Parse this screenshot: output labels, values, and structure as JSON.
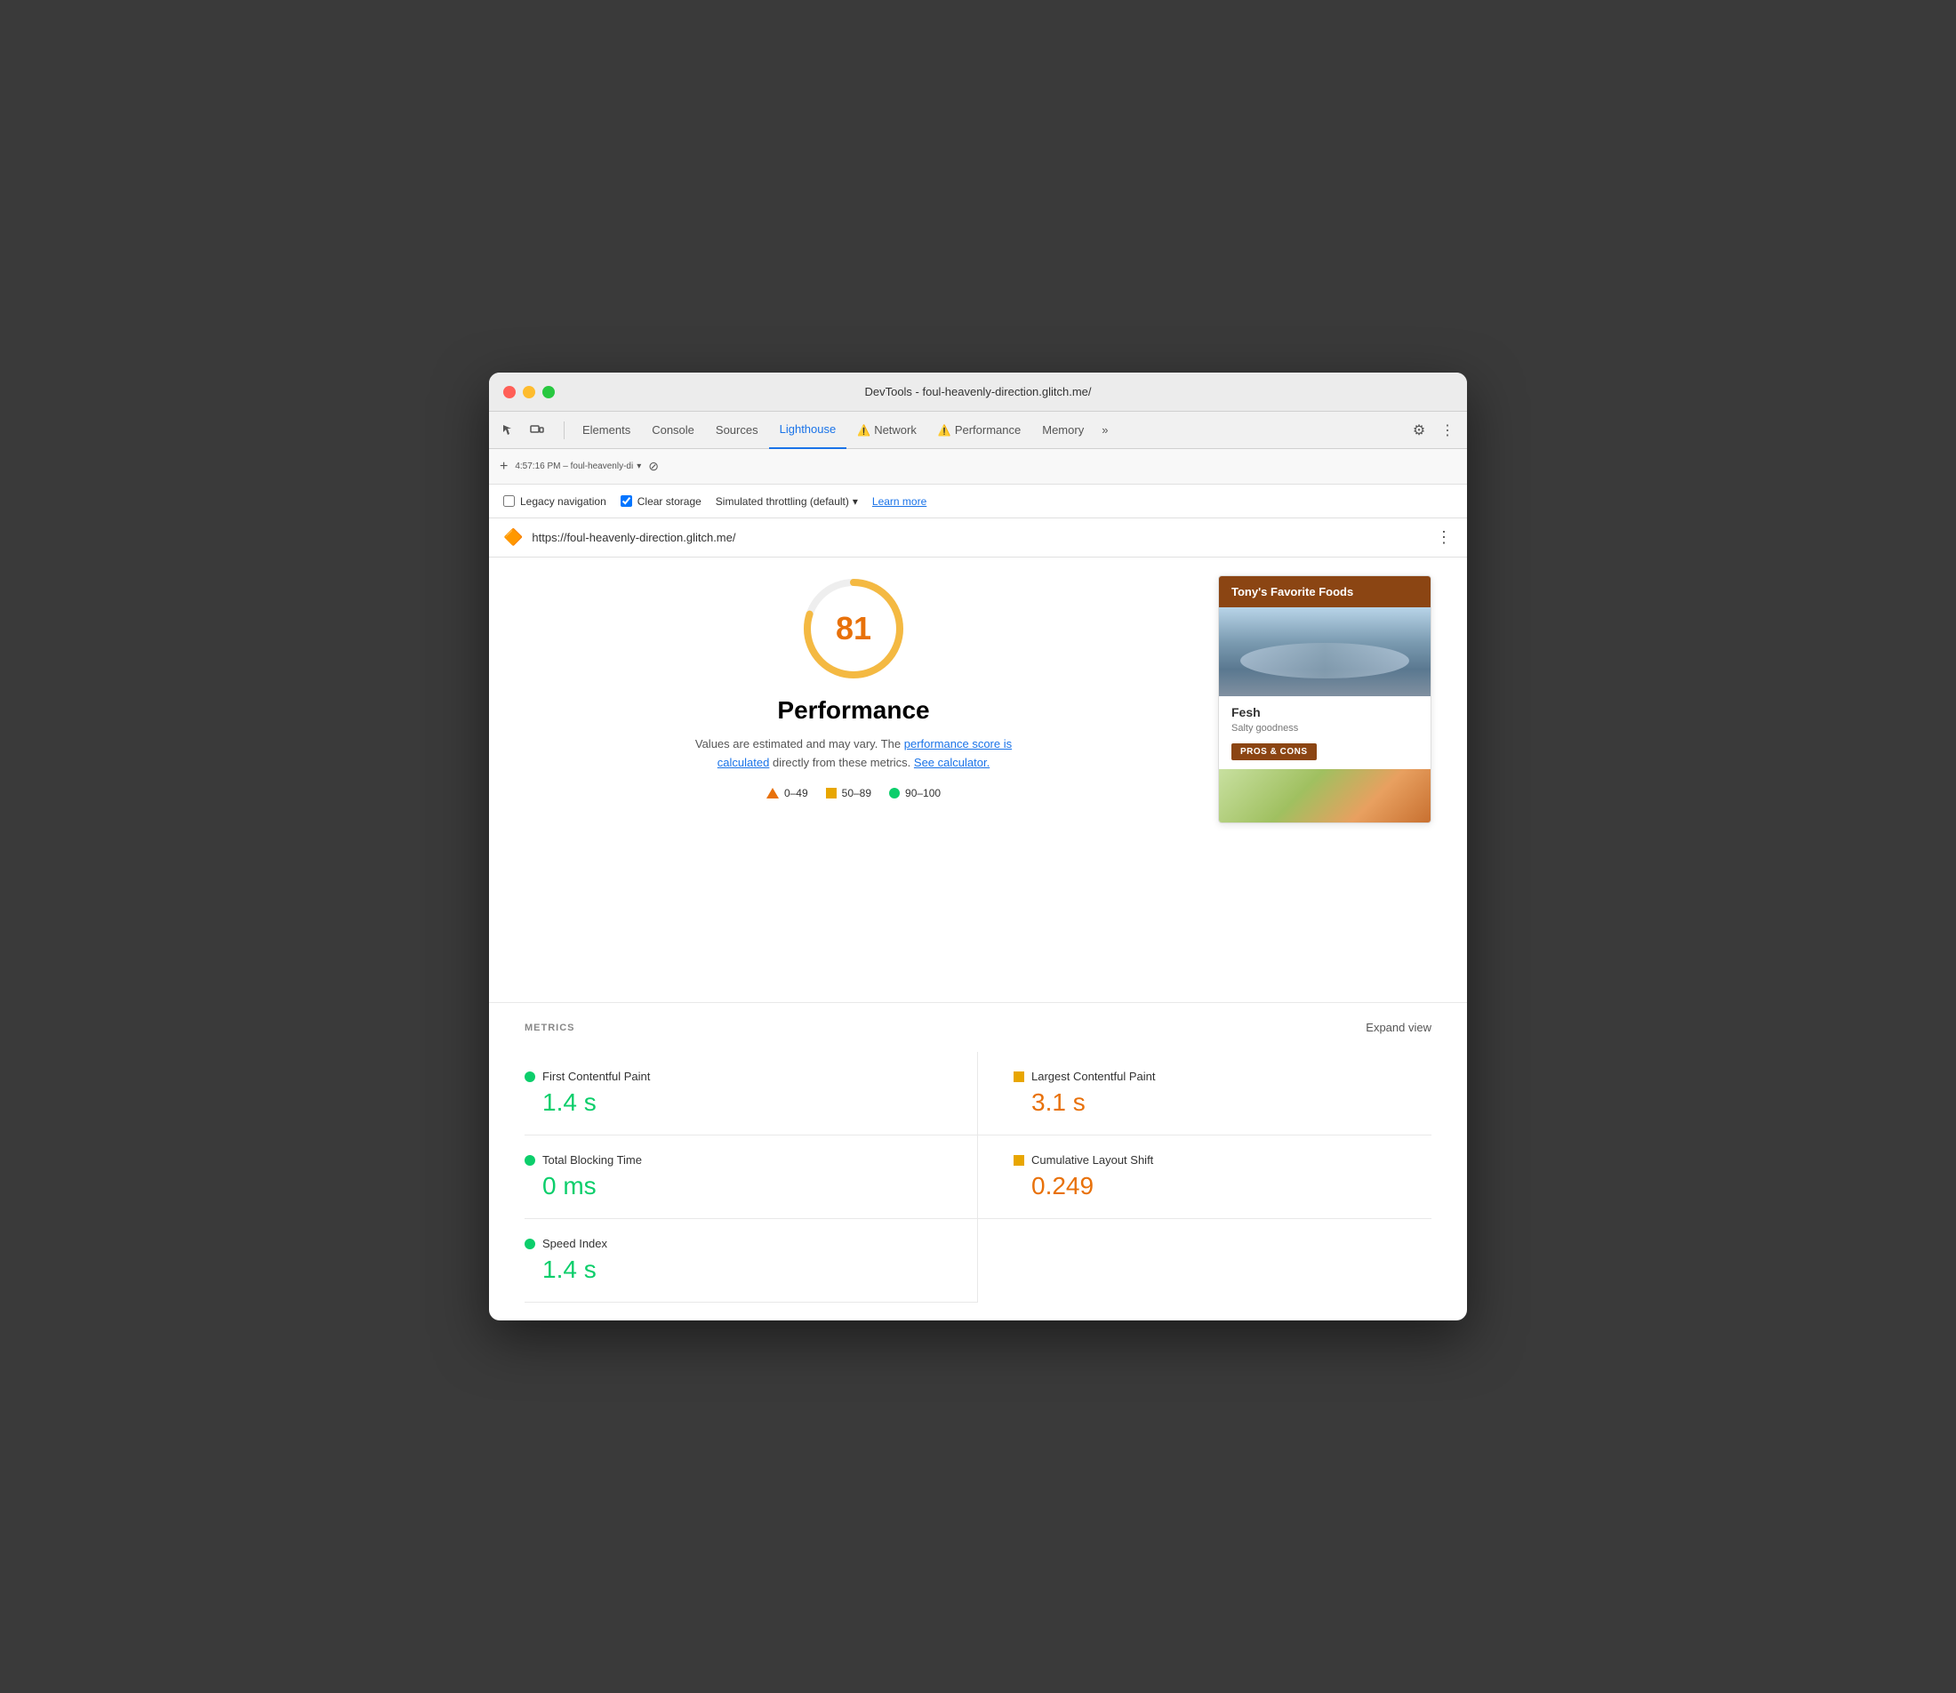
{
  "window": {
    "title": "DevTools - foul-heavenly-direction.glitch.me/"
  },
  "trafficLights": {
    "red": "close",
    "yellow": "minimize",
    "green": "maximize"
  },
  "devtools": {
    "tabs": [
      {
        "id": "elements",
        "label": "Elements",
        "active": false,
        "warning": false
      },
      {
        "id": "console",
        "label": "Console",
        "active": false,
        "warning": false
      },
      {
        "id": "sources",
        "label": "Sources",
        "active": false,
        "warning": false
      },
      {
        "id": "lighthouse",
        "label": "Lighthouse",
        "active": true,
        "warning": false
      },
      {
        "id": "network",
        "label": "Network",
        "active": false,
        "warning": true
      },
      {
        "id": "performance",
        "label": "Performance",
        "active": false,
        "warning": true
      },
      {
        "id": "memory",
        "label": "Memory",
        "active": false,
        "warning": false
      }
    ],
    "moreTabsLabel": "»"
  },
  "toolbar": {
    "addLabel": "+",
    "sessionText": "4:57:16 PM – foul-heavenly-di",
    "dropdownArrow": "▾",
    "stopIcon": "⊘"
  },
  "options": {
    "legacyNav": {
      "label": "Legacy navigation",
      "checked": false
    },
    "clearStorage": {
      "label": "Clear storage",
      "checked": true
    },
    "throttle": {
      "label": "Simulated throttling (default)",
      "arrow": "▾"
    },
    "learnMore": "Learn more"
  },
  "urlBar": {
    "icon": "🔶",
    "url": "https://foul-heavenly-direction.glitch.me/",
    "moreIcon": "⋮"
  },
  "scoreSection": {
    "score": "81",
    "title": "Performance",
    "description": "Values are estimated and may vary. The",
    "linkText1": "performance score is calculated",
    "descMid": "directly from these metrics.",
    "linkText2": "See calculator.",
    "legend": [
      {
        "id": "red",
        "range": "0–49"
      },
      {
        "id": "orange",
        "range": "50–89"
      },
      {
        "id": "green",
        "range": "90–100"
      }
    ]
  },
  "foodCard": {
    "title": "Tony's Favorite Foods",
    "imageFish": "fish-image",
    "foodName": "Fesh",
    "foodDesc": "Salty goodness",
    "prosConsLabel": "PROS & CONS"
  },
  "metrics": {
    "sectionTitle": "METRICS",
    "expandLabel": "Expand view",
    "items": [
      {
        "id": "fcp",
        "status": "green",
        "label": "First Contentful Paint",
        "value": "1.4 s"
      },
      {
        "id": "lcp",
        "status": "orange",
        "label": "Largest Contentful Paint",
        "value": "3.1 s"
      },
      {
        "id": "tbt",
        "status": "green",
        "label": "Total Blocking Time",
        "value": "0 ms"
      },
      {
        "id": "cls",
        "status": "orange",
        "label": "Cumulative Layout Shift",
        "value": "0.249"
      },
      {
        "id": "si",
        "status": "green",
        "label": "Speed Index",
        "value": "1.4 s"
      }
    ]
  }
}
